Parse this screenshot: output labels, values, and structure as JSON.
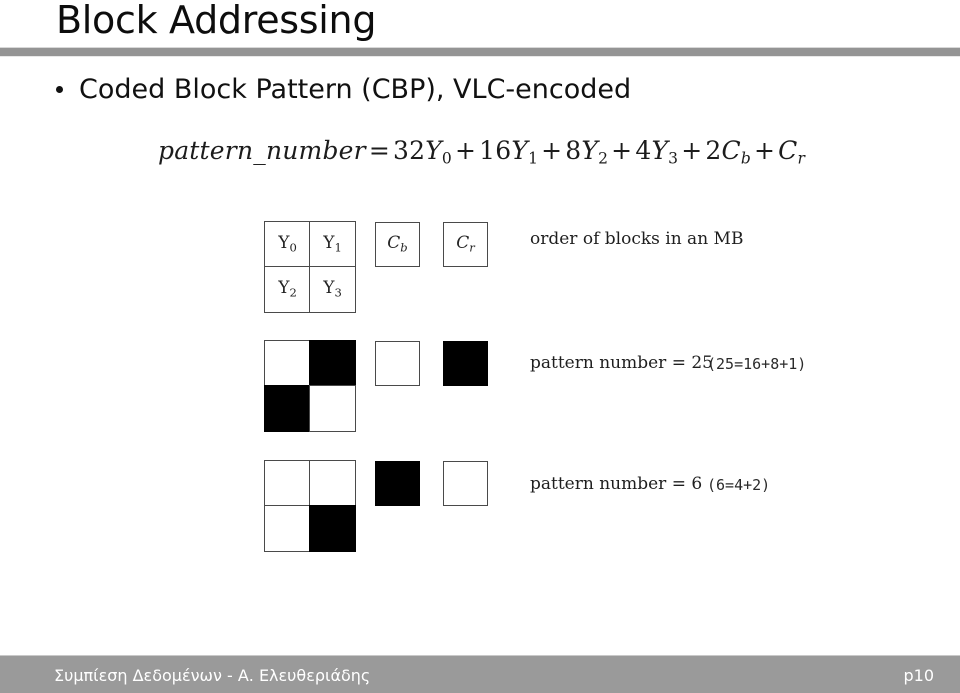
{
  "slide": {
    "title": "Block Addressing",
    "bullet": "Coded Block Pattern (CBP), VLC-encoded",
    "bullet_marker": "bullet-dot"
  },
  "figure": {
    "formula": {
      "lhs": "pattern_number",
      "equals": "=",
      "terms": [
        {
          "coef": "32",
          "sym": "Y",
          "sub": "0"
        },
        {
          "coef": "16",
          "sym": "Y",
          "sub": "1"
        },
        {
          "coef": "8",
          "sym": "Y",
          "sub": "2"
        },
        {
          "coef": "4",
          "sym": "Y",
          "sub": "3"
        },
        {
          "coef": "2",
          "sym": "C",
          "sub": "b"
        },
        {
          "coef": "",
          "sym": "C",
          "sub": "r"
        }
      ],
      "plain": "pattern_number = 32Y0 + 16Y1 + 8Y2 + 4Y3 + 2Cb + Cr"
    },
    "rows": [
      {
        "id": "legend",
        "luma_labels": [
          {
            "sym": "Y",
            "sub": "0"
          },
          {
            "sym": "Y",
            "sub": "1"
          },
          {
            "sym": "Y",
            "sub": "2"
          },
          {
            "sym": "Y",
            "sub": "3"
          }
        ],
        "luma_filled": [
          false,
          false,
          false,
          false
        ],
        "cb": {
          "sym": "C",
          "sub": "b",
          "filled": false
        },
        "cr": {
          "sym": "C",
          "sub": "r",
          "filled": false
        },
        "caption": "order of blocks in an MB",
        "note": ""
      },
      {
        "id": "example-25",
        "luma_labels": [],
        "luma_filled": [
          false,
          true,
          true,
          false
        ],
        "cb": {
          "sym": "",
          "sub": "",
          "filled": false
        },
        "cr": {
          "sym": "",
          "sub": "",
          "filled": true
        },
        "caption": "pattern number = 25",
        "note": "(25=16+8+1)"
      },
      {
        "id": "example-6",
        "luma_labels": [],
        "luma_filled": [
          false,
          false,
          false,
          true
        ],
        "cb": {
          "sym": "",
          "sub": "",
          "filled": true
        },
        "cr": {
          "sym": "",
          "sub": "",
          "filled": false
        },
        "caption": "pattern number = 6",
        "note": "(6=4+2)"
      }
    ]
  },
  "footer": {
    "credit": "Συμπίεση Δεδομένων - Α. Ελευθεριάδης",
    "page": "p10"
  },
  "colors": {
    "rule": "#949494",
    "footer_bar": "#9a9a9a",
    "block_fill": "#000000",
    "block_stroke": "#4a4a4a",
    "text": "#111111"
  }
}
